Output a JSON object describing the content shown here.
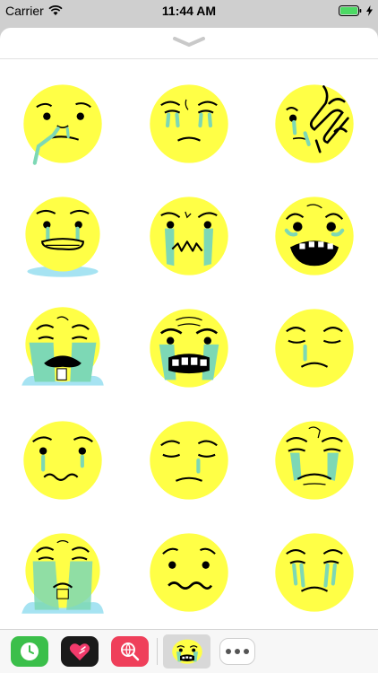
{
  "status_bar": {
    "carrier": "Carrier",
    "time": "11:44 AM",
    "icons": [
      "wifi-icon",
      "battery-icon",
      "charging-bolt-icon"
    ]
  },
  "sheet": {
    "grabber_icon": "chevron-down-icon"
  },
  "stickers": [
    "sad-drooling-face",
    "crying-face",
    "face-with-hand-on-face",
    "worried-face-puddle",
    "frowning-crying-face",
    "anguished-open-mouth-face",
    "sobbing-face-puddle",
    "grimacing-crying-face",
    "single-tear-face",
    "wavy-mouth-tear-face",
    "sad-sleepy-face",
    "crying-dizzy-face",
    "sobbing-flooded-face",
    "confounded-wavy-mouth-face",
    "pensive-crying-face"
  ],
  "app_drawer": {
    "apps": [
      "clock-app-icon",
      "heart-app-icon",
      "globe-search-app-icon"
    ],
    "selected": "sticker-pack-icon",
    "more": "more-apps-icon"
  },
  "colors": {
    "face_yellow": "#ffff46",
    "tear_teal": "#7dd8b5",
    "puddle_blue": "#a6e3f2"
  }
}
